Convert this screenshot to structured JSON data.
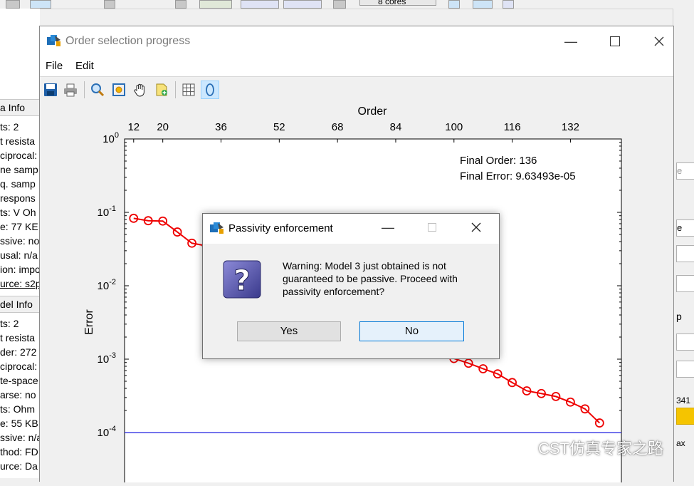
{
  "background": {
    "cores_label": "8 cores",
    "left_headers": [
      "a Info",
      "del Info"
    ],
    "left_lines_top": [
      "ts: 2",
      "t resista",
      "ciprocal:",
      "ne samp",
      "q. samp",
      "respons",
      "ts: V Oh",
      "e: 77 KE",
      "ssive: no",
      "usal: n/a",
      "ion: impo",
      "urce: s2p"
    ],
    "left_lines_bottom": [
      "ts: 2",
      "t resista",
      "der: 272",
      "ciprocal:",
      "te-space",
      "arse: no",
      "ts: Ohm",
      "e: 55 KB",
      "ssive: n/a",
      "thod: FD",
      "urce: Da"
    ],
    "right_fragments": [
      "e",
      "e",
      "p",
      "341",
      "ax"
    ]
  },
  "window": {
    "title": "Order selection progress",
    "menu": [
      "File",
      "Edit"
    ],
    "toolbar_icons": [
      "save-icon",
      "print-icon",
      "zoom-icon",
      "zoom-fit-icon",
      "pan-hand-icon",
      "data-cursor-icon",
      "grid-icon",
      "ellipse-icon"
    ]
  },
  "chart_data": {
    "type": "scatter",
    "title": "",
    "xlabel_top": "Order",
    "ylabel": "Error",
    "y_scale": "log",
    "ylim": [
      6e-05,
      1
    ],
    "xlim": [
      12,
      146
    ],
    "x_ticks": [
      12,
      20,
      36,
      52,
      68,
      84,
      100,
      116,
      132
    ],
    "y_ticks": [
      "10^0",
      "10^-1",
      "10^-2",
      "10^-3",
      "10^-4"
    ],
    "annotation": {
      "final_order": "Final Order: 136",
      "final_error": "Final Error: 9.63493e-05"
    },
    "threshold": 0.0001,
    "series": [
      {
        "color": "#ee0000",
        "x": [
          12,
          16,
          20,
          24,
          28,
          32,
          36,
          40,
          100,
          104,
          108,
          112,
          116,
          120,
          124,
          128,
          132,
          136,
          140
        ],
        "y": [
          0.083,
          0.077,
          0.076,
          0.054,
          0.038,
          0.035,
          0.025,
          0.0165,
          0.00102,
          0.00088,
          0.00074,
          0.00063,
          0.00048,
          0.00037,
          0.00034,
          0.00031,
          0.00026,
          0.00021,
          0.000135
        ]
      }
    ]
  },
  "dialog": {
    "title": "Passivity enforcement",
    "message": "Warning: Model 3 just obtained is not guaranteed to be passive. Proceed with passivity enforcement?",
    "yes_label": "Yes",
    "no_label": "No"
  },
  "watermark": "CST仿真专家之路"
}
